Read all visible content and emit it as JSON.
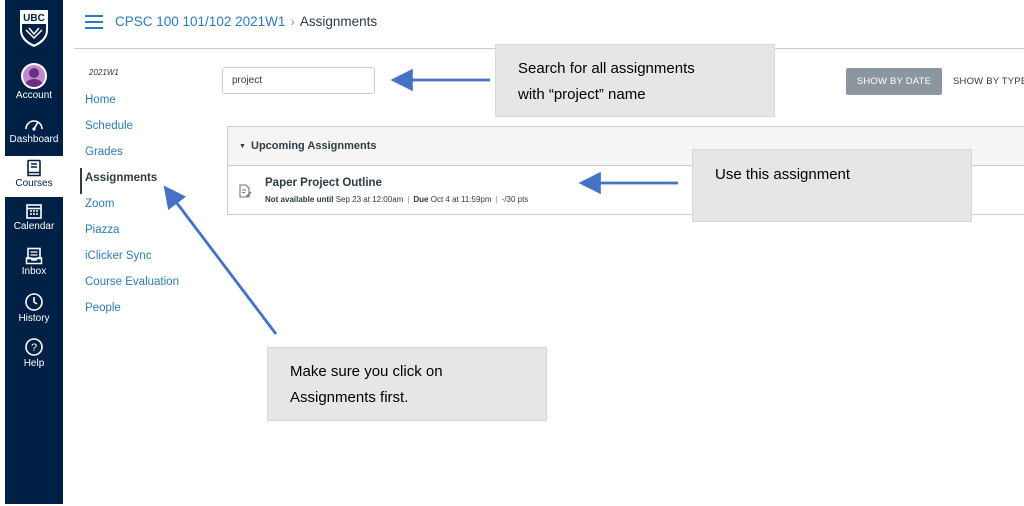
{
  "global_nav": {
    "logo_text": "UBC",
    "items": [
      {
        "label": "Account",
        "icon": "account-icon"
      },
      {
        "label": "Dashboard",
        "icon": "dashboard-icon"
      },
      {
        "label": "Courses",
        "icon": "courses-icon"
      },
      {
        "label": "Calendar",
        "icon": "calendar-icon"
      },
      {
        "label": "Inbox",
        "icon": "inbox-icon"
      },
      {
        "label": "History",
        "icon": "history-icon"
      },
      {
        "label": "Help",
        "icon": "help-icon"
      }
    ],
    "active": "Courses"
  },
  "header": {
    "course": "CPSC 100 101/102 2021W1",
    "separator": "›",
    "current": "Assignments"
  },
  "course_nav": {
    "term": "2021W1",
    "items": [
      "Home",
      "Schedule",
      "Grades",
      "Assignments",
      "Zoom",
      "Piazza",
      "iClicker Sync",
      "Course Evaluation",
      "People"
    ],
    "active": "Assignments"
  },
  "toolbar": {
    "search_value": "project",
    "show_by_date": "SHOW BY DATE",
    "show_by_type": "SHOW BY TYPE"
  },
  "group": {
    "title": "Upcoming Assignments",
    "assignment": {
      "title": "Paper Project Outline",
      "not_available_label": "Not available until",
      "not_available_value": "Sep 23 at 12:00am",
      "due_label": "Due",
      "due_value": "Oct 4 at 11:59pm",
      "points": "-/30 pts"
    }
  },
  "callouts": {
    "search": {
      "line1": "Search for all assignments",
      "line2": "with “project” name"
    },
    "assignment": {
      "line1": "Use this assignment"
    },
    "nav": {
      "line1": "Make sure you click on",
      "line2": "Assignments first."
    }
  },
  "colors": {
    "nav_bg": "#002145",
    "link": "#2b7abc",
    "arrow": "#4472c4",
    "callout_bg": "#e6e6e6",
    "button_gray": "#8b969e"
  }
}
